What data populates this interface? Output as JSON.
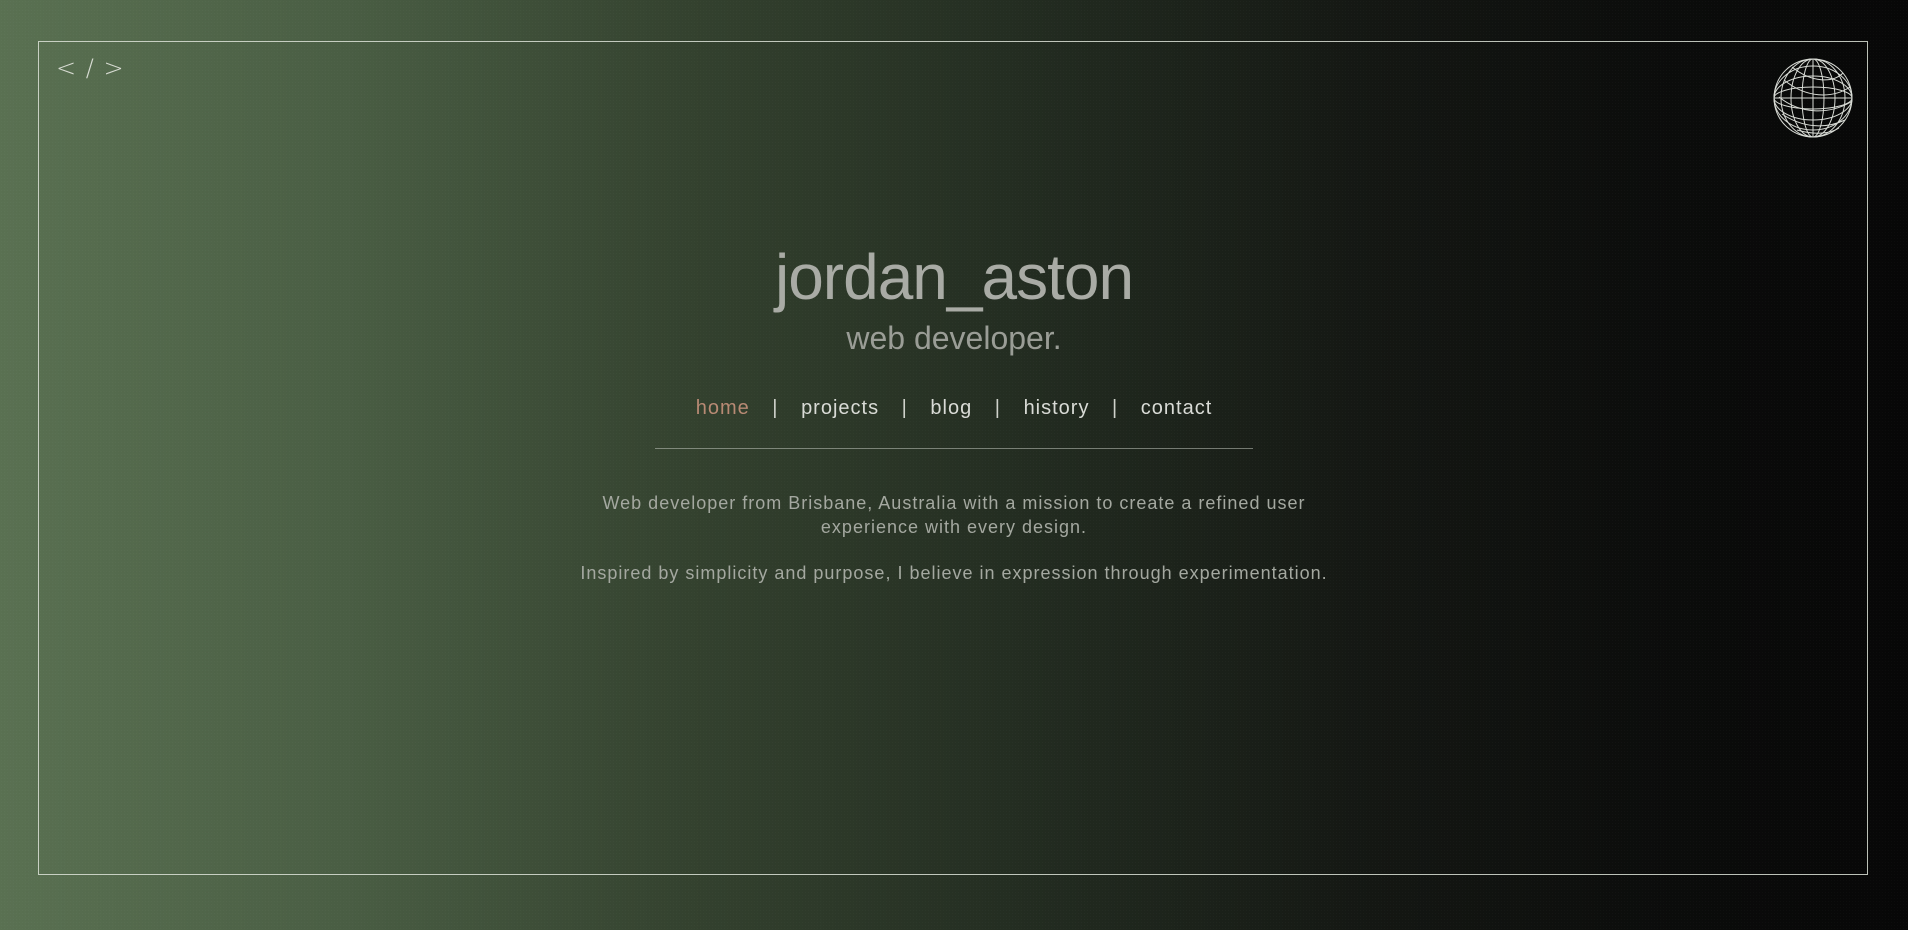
{
  "brand": {
    "logo_text": "< / >"
  },
  "hero": {
    "name": "jordan_aston",
    "role": "web developer."
  },
  "nav": {
    "items": [
      {
        "label": "home"
      },
      {
        "label": "projects"
      },
      {
        "label": "blog"
      },
      {
        "label": "history"
      },
      {
        "label": "contact"
      }
    ],
    "separator": "|"
  },
  "intro": {
    "paragraphs": [
      "Web developer from Brisbane, Australia with a mission to create a refined user experience with every design.",
      "Inspired by simplicity and purpose, I believe in expression through experimentation."
    ]
  },
  "icons": {
    "logo": "code-brackets-icon",
    "globe": "wireframe-globe-icon"
  },
  "colors": {
    "accent": "#b88a74",
    "text": "#d9dbd6"
  }
}
